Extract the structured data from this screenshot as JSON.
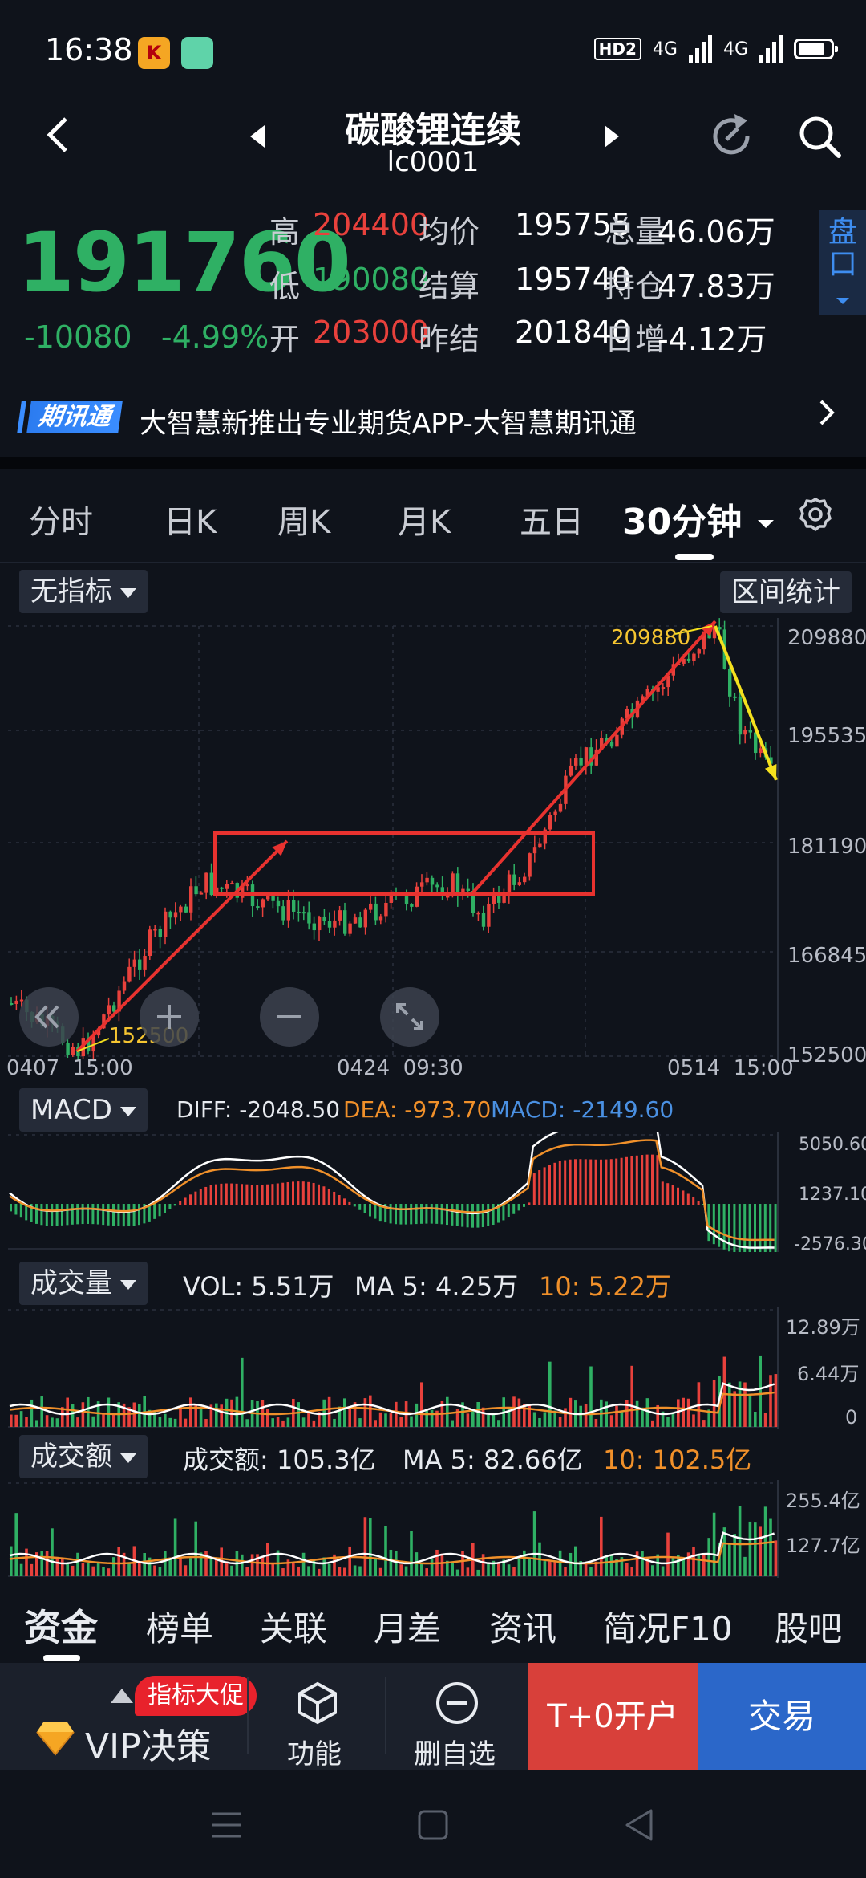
{
  "status": {
    "time": "16:38",
    "app1_label": "K",
    "hd": "HD2",
    "net1": "4G",
    "net2": "4G"
  },
  "header": {
    "title": "碳酸锂连续",
    "code": "lc0001"
  },
  "quote": {
    "price": "191760",
    "change": "-10080",
    "change_pct": "-4.99%",
    "rows": [
      [
        {
          "l": "高",
          "v": "204400",
          "c": "red"
        },
        {
          "l": "均价",
          "v": "195755"
        },
        {
          "l": "总量",
          "v": "46.06万"
        }
      ],
      [
        {
          "l": "低",
          "v": "190080",
          "c": "green"
        },
        {
          "l": "结算",
          "v": "195740"
        },
        {
          "l": "持仓",
          "v": "47.83万"
        }
      ],
      [
        {
          "l": "开",
          "v": "203000",
          "c": "red"
        },
        {
          "l": "昨结",
          "v": "201840"
        },
        {
          "l": "日增",
          "v": "-4.12万"
        }
      ]
    ],
    "panko": "盘口"
  },
  "banner": {
    "tag": "期讯通",
    "text": "大智慧新推出专业期货APP-大智慧期讯通"
  },
  "tabs": [
    "分时",
    "日K",
    "周K",
    "月K",
    "五日",
    "30分钟"
  ],
  "main_chart": {
    "indicator_label": "无指标",
    "range_stat_label": "区间统计",
    "y_ticks": [
      "209880",
      "195535",
      "181190",
      "166845",
      "152500"
    ],
    "x_ticks": [
      "0407  15:00",
      "0424  09:30",
      "0514  15:00"
    ],
    "high_label": "209880",
    "low_label": "152500"
  },
  "macd": {
    "label": "MACD",
    "diff": "DIFF: -2048.50",
    "dea": "DEA: -973.70",
    "macd": "MACD: -2149.60",
    "ticks": [
      "5050.60",
      "1237.10",
      "-2576.30"
    ]
  },
  "volume": {
    "label": "成交量",
    "vol": "VOL: 5.51万",
    "ma5": "MA 5: 4.25万",
    "ma10": "10: 5.22万",
    "ticks": [
      "12.89万",
      "6.44万",
      "0"
    ]
  },
  "amount": {
    "label": "成交额",
    "amt": "成交额: 105.3亿",
    "ma5": "MA 5: 82.66亿",
    "ma10": "10: 102.5亿",
    "ticks": [
      "255.4亿",
      "127.7亿"
    ]
  },
  "bottom_tabs": [
    "资金",
    "榜单",
    "关联",
    "月差",
    "资讯",
    "简况F10",
    "股吧"
  ],
  "actions": {
    "promo": "指标大促",
    "vip": "VIP决策",
    "func": "功能",
    "delete": "删自选",
    "t0": "T+0开户",
    "trade": "交易"
  },
  "colors": {
    "up": "#e8413c",
    "down": "#2fb064",
    "dea": "#f0902a",
    "macd": "#4a90e2"
  }
}
